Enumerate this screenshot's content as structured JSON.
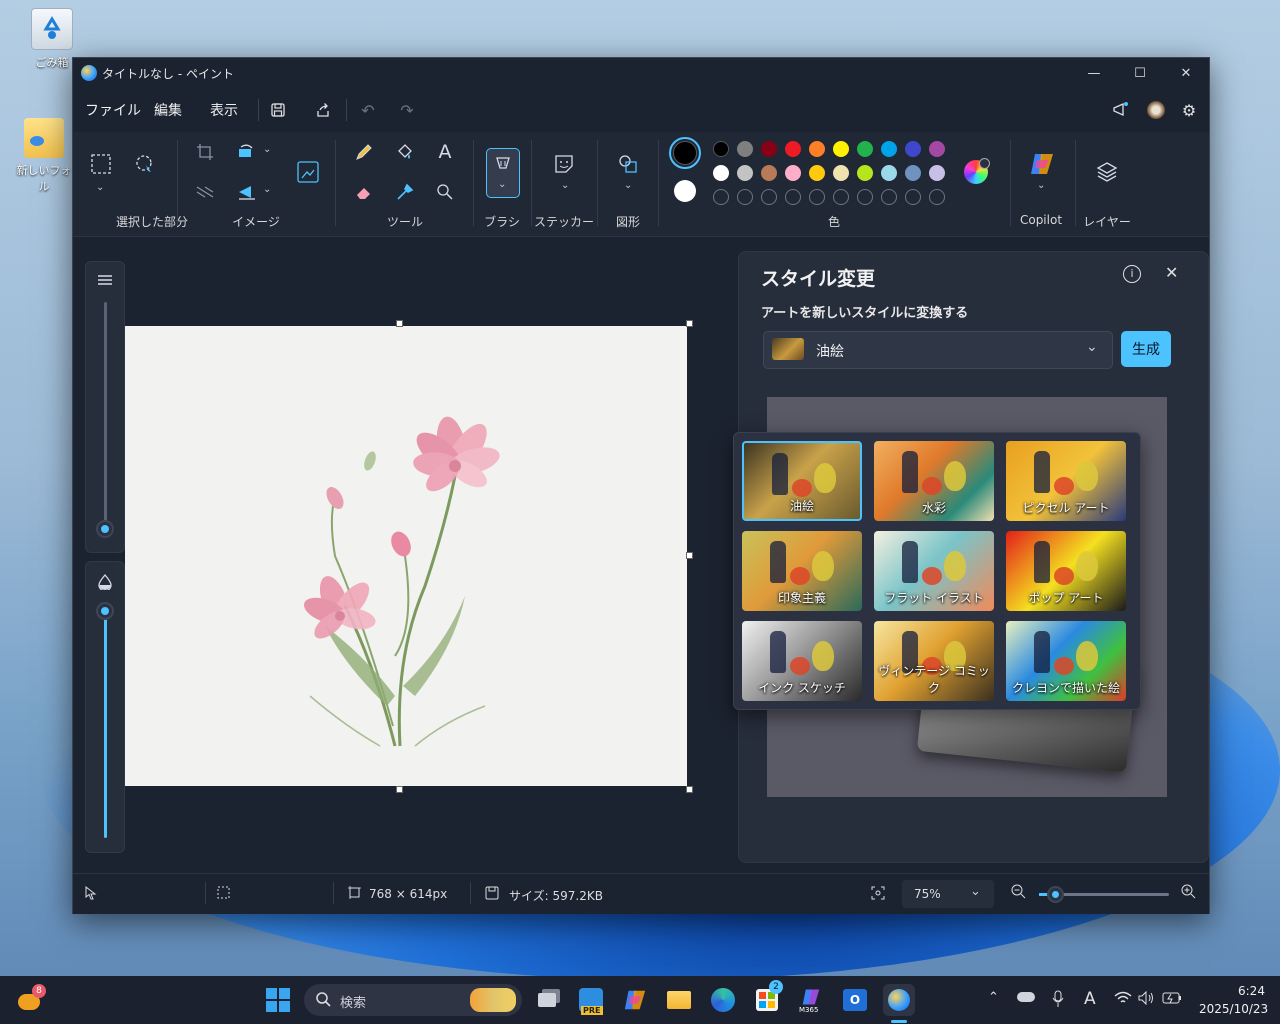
{
  "desktop": {
    "icons": [
      {
        "label": "ごみ箱"
      },
      {
        "label": "新しいフォル"
      }
    ]
  },
  "window": {
    "title": "タイトルなし - ペイント",
    "controls": {
      "minimize": "—",
      "maximize": "☐",
      "close": "✕"
    }
  },
  "menu": {
    "file": "ファイル",
    "edit": "編集",
    "view": "表示"
  },
  "ribbon": {
    "groups": {
      "selection": "選択した部分",
      "image": "イメージ",
      "tools": "ツール",
      "brush": "ブラシ",
      "sticker": "ステッカー",
      "shapes": "図形",
      "colors": "色",
      "copilot": "Copilot",
      "layers": "レイヤー"
    },
    "colors": {
      "primary": "#000000",
      "secondary": "#ffffff",
      "row1": [
        "#000000",
        "#7f7f7f",
        "#880015",
        "#ed1c24",
        "#ff7f27",
        "#fff200",
        "#22b14c",
        "#00a2e8",
        "#3f48cc",
        "#a349a4"
      ],
      "row2": [
        "#ffffff",
        "#c3c3c3",
        "#b97a57",
        "#ffaec9",
        "#ffc90e",
        "#efe4b0",
        "#b5e61d",
        "#99d9ea",
        "#7092be",
        "#c8bfe7"
      ]
    }
  },
  "style_panel": {
    "title": "スタイル変更",
    "subtitle": "アートを新しいスタイルに変換する",
    "selected_style": "油絵",
    "generate_label": "生成",
    "styles": [
      {
        "label": "油絵",
        "selected": true
      },
      {
        "label": "水彩"
      },
      {
        "label": "ピクセル アート"
      },
      {
        "label": "印象主義"
      },
      {
        "label": "フラット イラスト"
      },
      {
        "label": "ポップ アート"
      },
      {
        "label": "インク スケッチ"
      },
      {
        "label": "ヴィンテージ コミック"
      },
      {
        "label": "クレヨンで描いた絵"
      }
    ]
  },
  "statusbar": {
    "dimensions": "768 × 614px",
    "size": "サイズ: 597.2KB",
    "zoom": "75%"
  },
  "taskbar": {
    "search_placeholder": "検索",
    "widget_badge": "8",
    "store_badge": "2",
    "m365_label": "M365",
    "pre_label": "PRE",
    "time": "6:24",
    "date": "2025/10/23"
  },
  "accent": "#4cc2ff"
}
